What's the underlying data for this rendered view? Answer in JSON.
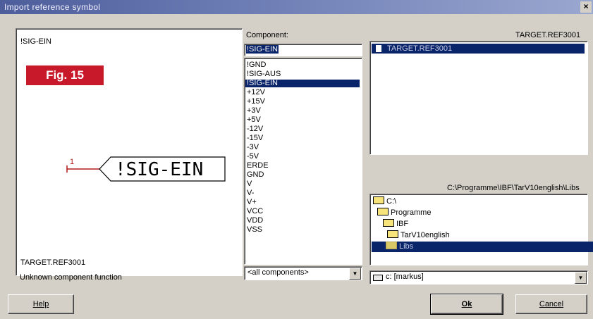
{
  "window": {
    "title": "Import reference symbol",
    "close_glyph": "×"
  },
  "preview": {
    "symbol_name": "!SIG-EIN",
    "fig_label": "Fig. 15",
    "pin_number": "1",
    "symbol_text": "!SIG-EIN",
    "target": "TARGET.REF3001",
    "status": "Unknown component function"
  },
  "component": {
    "label": "Component:",
    "input_value": "!SIG-EIN",
    "items": [
      "!GND",
      "!SIG-AUS",
      "!SIG-EIN",
      "+12V",
      "+15V",
      "+3V",
      "+5V",
      "-12V",
      "-15V",
      "-3V",
      "-5V",
      "ERDE",
      "GND",
      "V",
      "V-",
      "V+",
      "VCC",
      "VDD",
      "VSS"
    ],
    "selected_index": 2,
    "filter_value": "<all components>"
  },
  "reference": {
    "header": "TARGET.REF3001",
    "files": [
      "TARGET.REF3001"
    ],
    "path": "C:\\Programme\\IBF\\TarV10english\\Libs",
    "dirs": [
      "C:\\",
      "Programme",
      "IBF",
      "TarV10english",
      "Libs"
    ],
    "drive": "c: [markus]"
  },
  "buttons": {
    "help": "Help",
    "ok": "Ok",
    "cancel": "Cancel"
  },
  "colors": {
    "selection": "#0a246a",
    "fig_badge": "#c8192a",
    "pin": "#b01818"
  }
}
